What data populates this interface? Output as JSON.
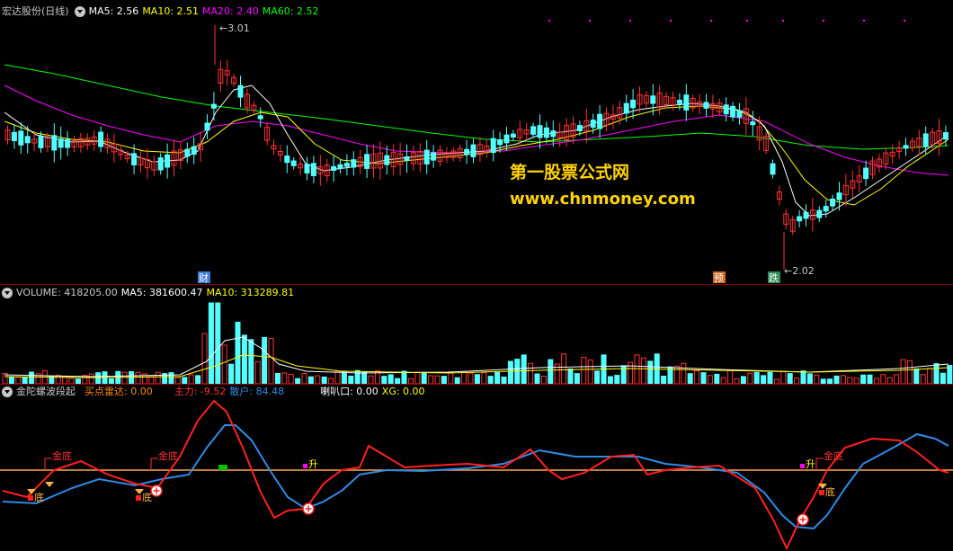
{
  "main": {
    "stock_name": "宏达股份(日线)",
    "ma5": "MA5: 2.56",
    "ma10": "MA10: 2.51",
    "ma20": "MA20: 2.40",
    "ma60": "MA60: 2.52",
    "high_label": "3.01",
    "low_label": "2.02",
    "markers": [
      "财",
      "预",
      "跌"
    ]
  },
  "volume": {
    "volume": "VOLUME: 418205.00",
    "ma5": "MA5: 381600.47",
    "ma10": "MA10: 313289.81"
  },
  "indicator": {
    "name": "金陀螺波段起",
    "buy_radar": "买点雷达: 0.00",
    "main_force": "主力: -9.52",
    "retail": "散户: 84.48",
    "trumpet": "喇叭口: 0.00",
    "xg": "XG: 0.00",
    "labels_jindi": [
      "金底",
      "金底",
      "金底"
    ],
    "labels_sheng": [
      "升",
      "升"
    ],
    "labels_di": [
      "底",
      "底",
      "底"
    ]
  },
  "watermark": {
    "title": "第一股票公式网",
    "url": "www.chnmoney.com"
  },
  "colors": {
    "up": "#ff3232",
    "down": "#54ffff",
    "ma5": "#ffffff",
    "ma10": "#ffff00",
    "ma20": "#ff00ff",
    "ma60": "#00ff00",
    "main_force": "#ff2020",
    "retail": "#2f8be6"
  }
}
